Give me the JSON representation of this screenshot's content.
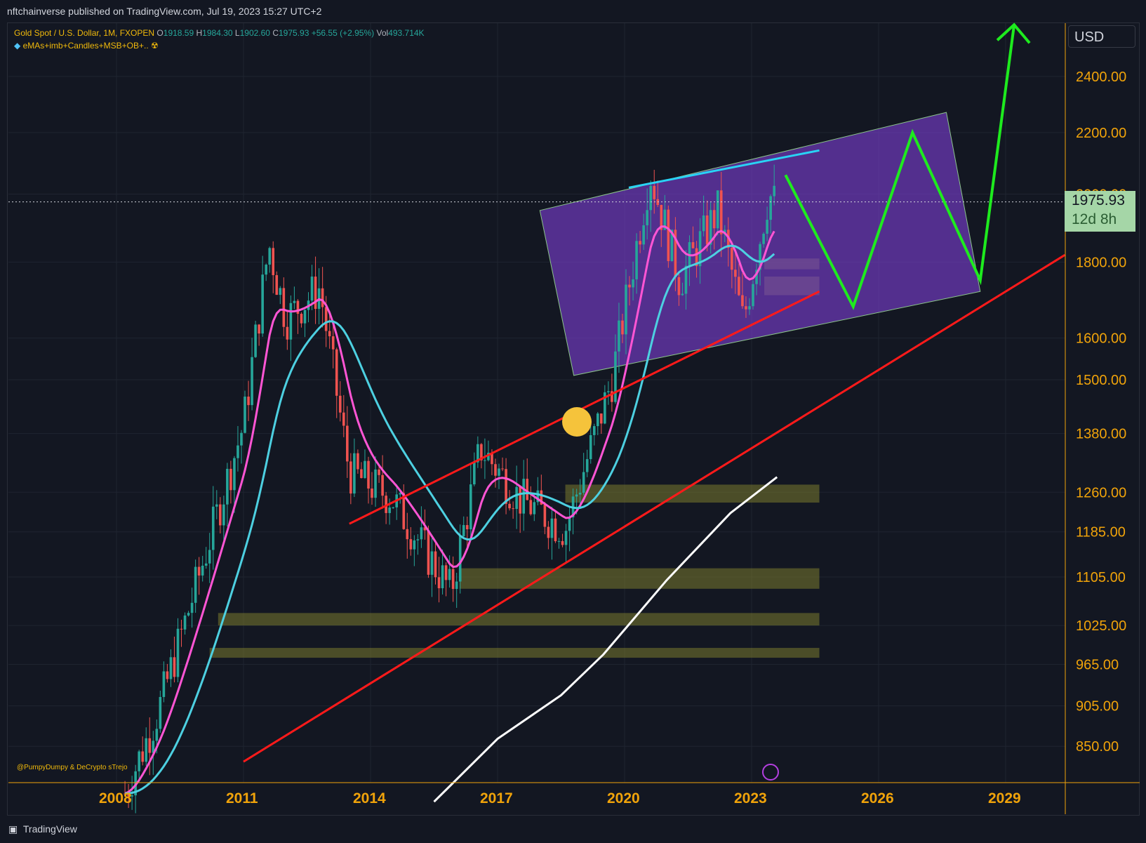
{
  "header": {
    "published_text": "nftchainverse published on TradingView.com, Jul 19, 2023 15:27 UTC+2"
  },
  "legend": {
    "symbol": "Gold Spot / U.S. Dollar, 1M, FXOPEN",
    "o_label": "O",
    "o_value": "1918.59",
    "h_label": "H",
    "h_value": "1984.30",
    "l_label": "L",
    "l_value": "1902.60",
    "c_label": "C",
    "c_value": "1975.93",
    "change": "+56.55 (+2.95%)",
    "vol_label": "Vol",
    "vol_value": "493.714K",
    "indicator": "eMAs+imb+Candles+MSB+OB+..",
    "indicator_icon": "diamond-icon",
    "indicator_icon2": "radiation-icon"
  },
  "currency": "USD",
  "last_price": {
    "value": "1975.93",
    "countdown": "12d 8h"
  },
  "watermark": "@PumpyDumpy & DeCrypto sTrejo",
  "footer": {
    "brand": "TradingView"
  },
  "colors": {
    "background": "#131722",
    "axis_text": "#f0a30a",
    "channel_fill": "#7b3fd1",
    "support_line": "#ff1a1a",
    "projection": "#1eeb1e",
    "ema_long": "#ffffff",
    "bull": "#26a69a",
    "bear": "#ef5350"
  },
  "chart_data": {
    "type": "line",
    "title": "Gold Spot / U.S. Dollar, 1M, FXOPEN",
    "xlabel": "",
    "ylabel": "",
    "y_scale": "log",
    "x_ticks": [
      "2008",
      "2011",
      "2014",
      "2017",
      "2020",
      "2023",
      "2026",
      "2029"
    ],
    "y_ticks": [
      850,
      905,
      965,
      1025,
      1105,
      1185,
      1260,
      1380,
      1500,
      1600,
      1800,
      2000,
      2200,
      2400
    ],
    "last_price": 1975.93,
    "grid": true,
    "price_path": [
      {
        "x": 2008.2,
        "y": 790
      },
      {
        "x": 2009.0,
        "y": 900
      },
      {
        "x": 2010.0,
        "y": 1120
      },
      {
        "x": 2011.0,
        "y": 1400
      },
      {
        "x": 2011.6,
        "y": 1850
      },
      {
        "x": 2012.0,
        "y": 1650
      },
      {
        "x": 2012.8,
        "y": 1730
      },
      {
        "x": 2013.5,
        "y": 1300
      },
      {
        "x": 2014.5,
        "y": 1250
      },
      {
        "x": 2015.9,
        "y": 1080
      },
      {
        "x": 2016.6,
        "y": 1350
      },
      {
        "x": 2017.5,
        "y": 1250
      },
      {
        "x": 2018.6,
        "y": 1190
      },
      {
        "x": 2019.7,
        "y": 1500
      },
      {
        "x": 2020.6,
        "y": 2070
      },
      {
        "x": 2021.3,
        "y": 1750
      },
      {
        "x": 2022.2,
        "y": 1950
      },
      {
        "x": 2022.8,
        "y": 1640
      },
      {
        "x": 2023.4,
        "y": 2000
      },
      {
        "x": 2023.55,
        "y": 1975.93
      }
    ],
    "ema_long": [
      {
        "x": 2015.5,
        "y": 780
      },
      {
        "x": 2017.0,
        "y": 860
      },
      {
        "x": 2018.5,
        "y": 920
      },
      {
        "x": 2019.5,
        "y": 980
      },
      {
        "x": 2021.0,
        "y": 1100
      },
      {
        "x": 2022.5,
        "y": 1220
      },
      {
        "x": 2023.6,
        "y": 1290
      }
    ],
    "support_line": [
      {
        "x": 2011.0,
        "y": 830
      },
      {
        "x": 2030.4,
        "y": 1820
      }
    ],
    "inner_trend": [
      {
        "x": 2013.5,
        "y": 1200
      },
      {
        "x": 2024.6,
        "y": 1720
      }
    ],
    "channel": [
      {
        "x": 2018.0,
        "y": 1950
      },
      {
        "x": 2027.6,
        "y": 2270
      },
      {
        "x": 2028.4,
        "y": 1720
      },
      {
        "x": 2018.8,
        "y": 1510
      }
    ],
    "resistance": [
      {
        "x": 2020.1,
        "y": 2020
      },
      {
        "x": 2024.6,
        "y": 2140
      }
    ],
    "projection": [
      {
        "x": 2023.8,
        "y": 2060
      },
      {
        "x": 2025.4,
        "y": 1680
      },
      {
        "x": 2026.8,
        "y": 2200
      },
      {
        "x": 2028.4,
        "y": 1750
      },
      {
        "x": 2029.2,
        "y": 2600
      }
    ],
    "supply_zones": [
      {
        "from": 2018.6,
        "to": 2024.6,
        "low": 1240,
        "high": 1275
      },
      {
        "from": 2016.1,
        "to": 2024.6,
        "low": 1085,
        "high": 1120
      },
      {
        "from": 2010.4,
        "to": 2024.6,
        "low": 1025,
        "high": 1045
      },
      {
        "from": 2010.2,
        "to": 2024.6,
        "low": 975,
        "high": 990
      },
      {
        "from": 2023.3,
        "to": 2024.6,
        "low": 1710,
        "high": 1760
      },
      {
        "from": 2023.3,
        "to": 2024.6,
        "low": 1780,
        "high": 1810
      }
    ]
  }
}
